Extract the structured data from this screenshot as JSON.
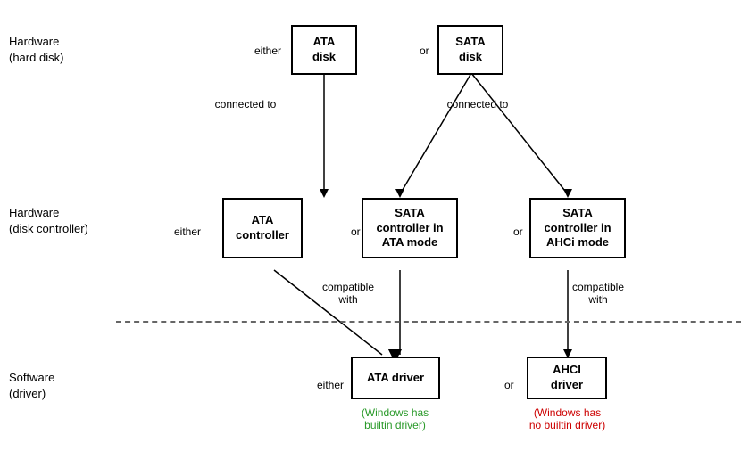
{
  "labels": {
    "hardware_hd": "Hardware\n(hard disk)",
    "hardware_dc": "Hardware\n(disk controller)",
    "software_drv": "Software\n(driver)",
    "either1": "either",
    "either2": "either",
    "either3": "either",
    "or1": "or",
    "or2": "or",
    "or3": "or",
    "or4": "or",
    "connected_to1": "connected to",
    "connected_to2": "connected to",
    "compatible_with1": "compatible\nwith",
    "compatible_with2": "compatible\nwith"
  },
  "boxes": {
    "ata_disk": "ATA\ndisk",
    "sata_disk": "SATA\ndisk",
    "ata_controller": "ATA\ncontroller",
    "sata_controller_ata": "SATA\ncontroller in\nATA mode",
    "sata_controller_ahci": "SATA\ncontroller in\nAHCi mode",
    "ata_driver": "ATA driver",
    "ahci_driver": "AHCI\ndriver"
  },
  "notes": {
    "ata_note": "(Windows has\nbuiltin driver)",
    "ahci_note": "(Windows has\nno builtin driver)"
  },
  "colors": {
    "box_border": "#000000",
    "line": "#000000",
    "dashed": "#666666",
    "green": "#2a9a2a",
    "red": "#cc0000"
  }
}
